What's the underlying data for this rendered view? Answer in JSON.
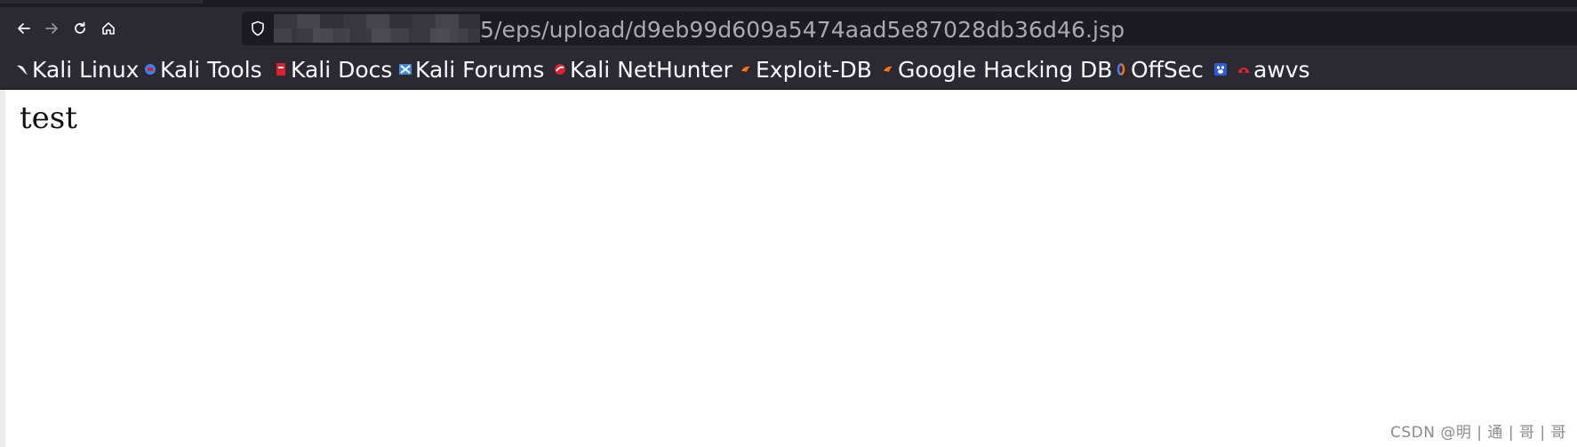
{
  "browser": {
    "url_visible": "5/eps/upload/d9eb99d609a5474aad5e87028db36d46.jsp",
    "icons": {
      "back": "back-arrow-icon",
      "forward": "forward-arrow-icon",
      "reload": "reload-icon",
      "home": "home-icon",
      "site_info": "shield-icon"
    }
  },
  "bookmarks": [
    {
      "label": "Kali Linux",
      "icon": "kali-dragon-icon",
      "color": "#f2f2f2"
    },
    {
      "label": "Kali Tools",
      "icon": "kali-tools-icon",
      "color": "#3b82f6"
    },
    {
      "label": "Kali Docs",
      "icon": "kali-docs-icon",
      "color": "#e11d2e"
    },
    {
      "label": "Kali Forums",
      "icon": "kali-forums-icon",
      "color": "#3d8bd9"
    },
    {
      "label": "Kali NetHunter",
      "icon": "nethunter-icon",
      "color": "#e11d2e"
    },
    {
      "label": "Exploit-DB",
      "icon": "exploit-db-icon",
      "color": "#f97316"
    },
    {
      "label": "Google Hacking DB",
      "icon": "ghdb-icon",
      "color": "#f97316"
    },
    {
      "label": "OffSec",
      "icon": "offsec-icon",
      "color": "#3b82f6"
    },
    {
      "label": "",
      "icon": "baidu-icon",
      "color": "#2f5bd8"
    },
    {
      "label": "awvs",
      "icon": "awvs-icon",
      "color": "#dc2626"
    }
  ],
  "page": {
    "body_text": "test"
  },
  "watermark": "CSDN @明 | 通 | 哥 | 哥"
}
